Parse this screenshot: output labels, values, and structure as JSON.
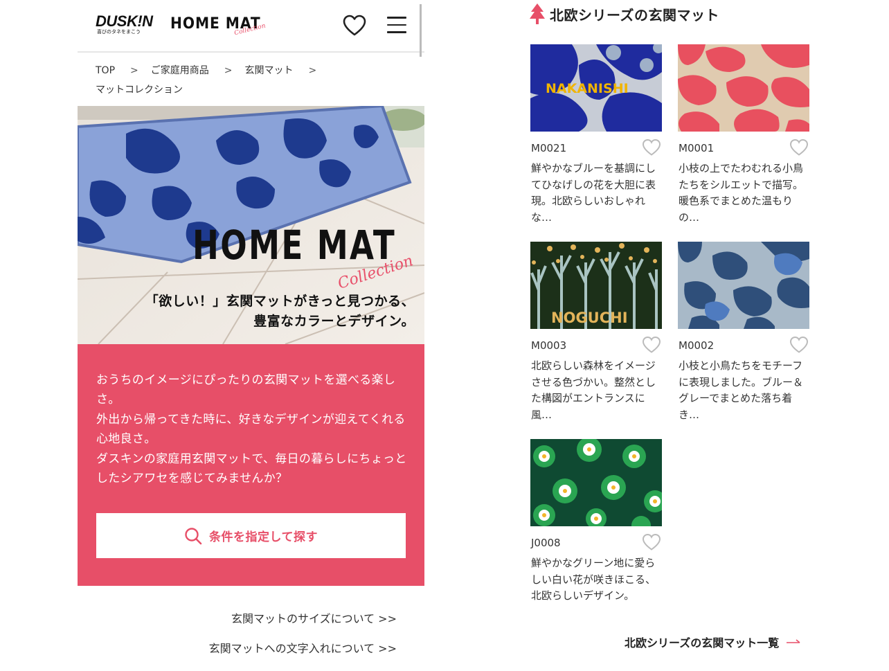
{
  "header": {
    "logo_brand": "DUSK!N",
    "logo_tagline": "喜びのタネをまこう",
    "logo_title": "HOME MAT",
    "logo_script": "Collection",
    "favorite_icon": "heart-outline-icon",
    "menu_icon": "hamburger-menu-icon"
  },
  "breadcrumb": {
    "items": [
      "TOP",
      "ご家庭用商品",
      "玄関マット",
      "マットコレクション"
    ],
    "separator": ">"
  },
  "hero": {
    "title": "HOME MAT",
    "script": "Collection",
    "copy_line1": "「欲しい！」玄関マットがきっと見つかる、",
    "copy_line2": "豊富なカラーとデザイン。"
  },
  "intro": {
    "line1": "おうちのイメージにぴったりの玄関マットを選べる楽しさ。",
    "line2": "外出から帰ってきた時に、好きなデザインが迎えてくれる心地良さ。",
    "line3": "ダスキンの家庭用玄関マットで、毎日の暮らしにちょっとしたシアワセを感じてみませんか？",
    "search_button": "条件を指定して探す",
    "search_icon": "search-icon"
  },
  "links": {
    "size": "玄関マットのサイズについて >>",
    "lettering": "玄関マットへの文字入れについて >>"
  },
  "nordic": {
    "title": "北欧シリーズの玄関マット",
    "title_icon": "tree-icon",
    "more_link": "北欧シリーズの玄関マット一覧",
    "more_icon": "arrow-right-icon",
    "products": [
      {
        "code": "M0021",
        "thumb_label": "NAKANISHI",
        "desc": "鮮やかなブルーを基調にしてひなげしの花を大胆に表現。北欧らしいおしゃれな…"
      },
      {
        "code": "M0001",
        "thumb_label": "",
        "desc": "小枝の上でたわむれる小鳥たちをシルエットで描写。暖色系でまとめた温もりの…"
      },
      {
        "code": "M0003",
        "thumb_label": "NOGUCHI",
        "desc": "北欧らしい森林をイメージさせる色づかい。整然とした構図がエントランスに風…"
      },
      {
        "code": "M0002",
        "thumb_label": "",
        "desc": "小枝と小鳥たちをモチーフに表現しました。ブルー＆グレーでまとめた落ち着き…"
      },
      {
        "code": "J0008",
        "thumb_label": "",
        "desc": "鮮やかなグリーン地に愛らしい白い花が咲きほこる、北欧らしいデザイン。"
      }
    ]
  },
  "colors": {
    "accent_pink": "#e74f68",
    "text_dark": "#222222"
  }
}
